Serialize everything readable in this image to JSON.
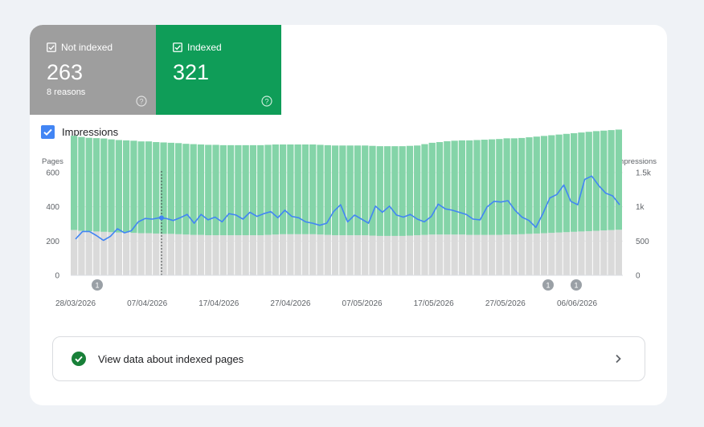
{
  "tiles": {
    "not_indexed": {
      "label": "Not indexed",
      "count": "263",
      "sub": "8 reasons",
      "color": "#9e9e9e",
      "checked": true
    },
    "indexed": {
      "label": "Indexed",
      "count": "321",
      "color": "#0f9d58",
      "checked": true
    }
  },
  "impressions_toggle": {
    "label": "Impressions",
    "checked": true
  },
  "chart_data": {
    "type": "bar",
    "left_axis_label": "Pages",
    "right_axis_label": "Impressions",
    "left_ticks": [
      "600",
      "400",
      "200",
      "0"
    ],
    "right_ticks": [
      "1.5k",
      "1k",
      "500",
      "0"
    ],
    "left_ylim": [
      0,
      600
    ],
    "right_ylim": [
      0,
      1500
    ],
    "x_tick_labels": [
      "28/03/2026",
      "07/04/2026",
      "17/04/2026",
      "27/04/2026",
      "07/05/2026",
      "17/05/2026",
      "27/05/2026",
      "06/06/2026"
    ],
    "annotations": [
      "1",
      "1",
      "1"
    ],
    "series": [
      {
        "name": "Not indexed",
        "color": "#dadada",
        "values": [
          265,
          260,
          258,
          256,
          254,
          252,
          250,
          250,
          248,
          246,
          246,
          244,
          242,
          242,
          240,
          238,
          236,
          236,
          234,
          234,
          234,
          234,
          234,
          234,
          234,
          234,
          236,
          238,
          240,
          240,
          240,
          240,
          240,
          238,
          236,
          234,
          234,
          234,
          234,
          234,
          232,
          230,
          230,
          230,
          230,
          232,
          234,
          236,
          238,
          238,
          238,
          238,
          238,
          236,
          236,
          236,
          236,
          236,
          238,
          238,
          240,
          242,
          244,
          246,
          248,
          250,
          252,
          254,
          256,
          258,
          260,
          262,
          264,
          266
        ]
      },
      {
        "name": "Indexed",
        "color": "#84d4a8",
        "values": [
          550,
          548,
          545,
          545,
          545,
          542,
          540,
          538,
          538,
          536,
          536,
          534,
          534,
          532,
          532,
          530,
          530,
          528,
          528,
          528,
          526,
          526,
          526,
          526,
          526,
          526,
          526,
          526,
          524,
          524,
          524,
          524,
          524,
          524,
          524,
          524,
          524,
          524,
          524,
          524,
          524,
          524,
          524,
          524,
          524,
          524,
          524,
          530,
          536,
          540,
          545,
          548,
          550,
          552,
          554,
          556,
          558,
          560,
          562,
          562,
          562,
          564,
          566,
          568,
          570,
          572,
          574,
          576,
          578,
          580,
          582,
          583,
          584,
          585
        ]
      },
      {
        "name": "Impressions",
        "color": "#4285f4",
        "values": [
          530,
          640,
          640,
          580,
          510,
          570,
          680,
          620,
          650,
          780,
          830,
          820,
          840,
          830,
          800,
          840,
          890,
          760,
          890,
          810,
          850,
          780,
          900,
          880,
          820,
          920,
          860,
          900,
          930,
          840,
          950,
          860,
          840,
          780,
          760,
          730,
          760,
          930,
          1030,
          780,
          880,
          820,
          760,
          1010,
          920,
          1010,
          880,
          850,
          890,
          820,
          780,
          860,
          1040,
          970,
          950,
          920,
          890,
          820,
          810,
          1000,
          1080,
          1070,
          1090,
          950,
          850,
          800,
          700,
          900,
          1130,
          1180,
          1320,
          1080,
          1030,
          1400,
          1450,
          1310,
          1200,
          1160,
          1030
        ]
      }
    ]
  },
  "view_link": {
    "label": "View data about indexed pages"
  }
}
